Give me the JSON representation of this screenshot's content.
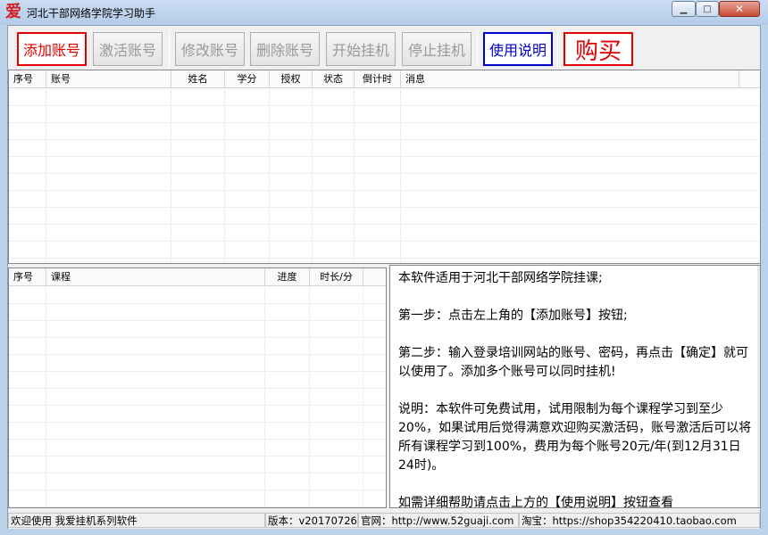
{
  "window": {
    "title": "河北干部网络学院学习助手",
    "icon_glyph": "爱",
    "min_glyph": "▁",
    "max_glyph": "□",
    "close_glyph": "✕"
  },
  "toolbar": {
    "add_label": "添加账号",
    "activate_label": "激活账号",
    "modify_label": "修改账号",
    "delete_label": "删除账号",
    "start_label": "开始挂机",
    "stop_label": "停止挂机",
    "help_label": "使用说明",
    "buy_label": "购买"
  },
  "accounts_table": {
    "columns": [
      "序号",
      "账号",
      "姓名",
      "学分",
      "授权",
      "状态",
      "倒计时",
      "消息"
    ],
    "rows": []
  },
  "courses_table": {
    "columns": [
      "序号",
      "课程",
      "进度",
      "时长/分"
    ],
    "rows": []
  },
  "info": {
    "text": "本软件适用于河北干部网络学院挂课;\n\n第一步：点击左上角的【添加账号】按钮;\n\n第二步：输入登录培训网站的账号、密码，再点击【确定】就可以使用了。添加多个账号可以同时挂机!\n\n说明：本软件可免费试用，试用限制为每个课程学习到至少20%，如果试用后觉得满意欢迎购买激活码，账号激活后可以将所有课程学习到100%，费用为每个账号20元/年(到12月31日24时)。\n\n如需详细帮助请点击上方的【使用说明】按钮查看"
  },
  "status": {
    "welcome": "欢迎使用 我爱挂机系列软件",
    "version": "版本：v20170726",
    "website": "官网：http://www.52guaji.com",
    "taobao": "淘宝：https://shop354220410.taobao.com"
  },
  "colors": {
    "accent_red": "#e00000",
    "accent_blue": "#0000cc"
  }
}
